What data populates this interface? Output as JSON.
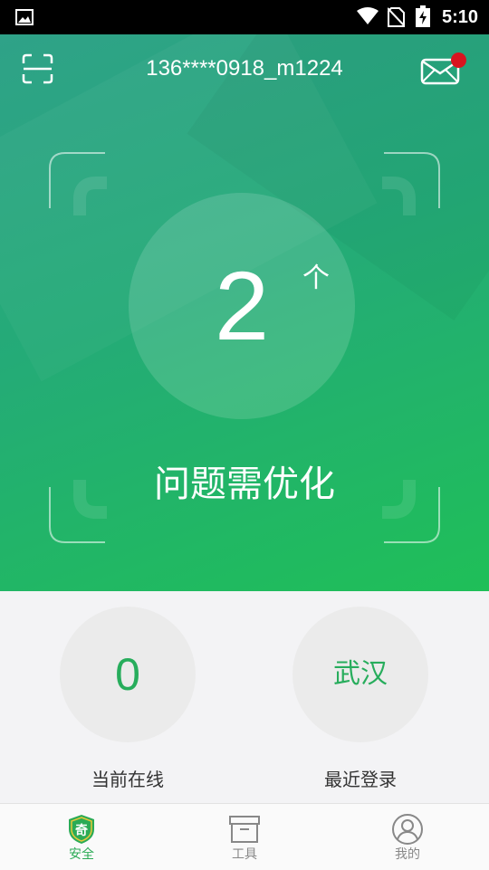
{
  "status_bar": {
    "time": "5:10",
    "icons": [
      "gallery-icon",
      "wifi-icon",
      "no-sim-icon",
      "battery-charging-icon"
    ]
  },
  "header": {
    "account": "136****0918_m1224",
    "scan_icon": "scan-icon",
    "mail_icon": "mail-icon",
    "has_unread": true
  },
  "security": {
    "count": "2",
    "unit": "个",
    "description": "问题需优化"
  },
  "stats": [
    {
      "value": "0",
      "label": "当前在线"
    },
    {
      "value": "武汉",
      "label": "最近登录"
    }
  ],
  "nav": [
    {
      "label": "安全",
      "icon": "shield-icon",
      "active": true
    },
    {
      "label": "工具",
      "icon": "toolbox-icon",
      "active": false
    },
    {
      "label": "我的",
      "icon": "user-icon",
      "active": false
    }
  ],
  "colors": {
    "hero_start": "#2fa288",
    "hero_end": "#1fbf58",
    "accent_green": "#27ad5c",
    "badge_red": "#d8141f"
  }
}
